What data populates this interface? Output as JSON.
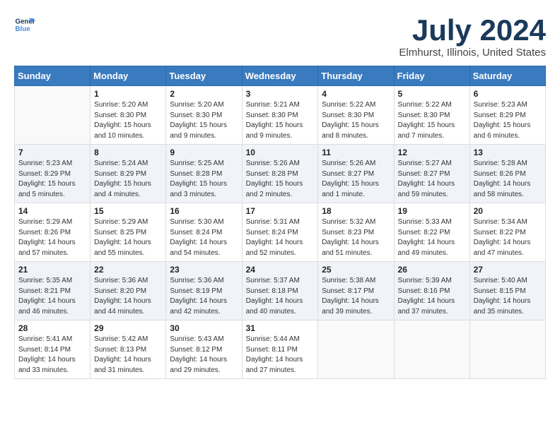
{
  "header": {
    "logo_line1": "General",
    "logo_line2": "Blue",
    "month_year": "July 2024",
    "location": "Elmhurst, Illinois, United States"
  },
  "weekdays": [
    "Sunday",
    "Monday",
    "Tuesday",
    "Wednesday",
    "Thursday",
    "Friday",
    "Saturday"
  ],
  "weeks": [
    [
      {
        "day": "",
        "sunrise": "",
        "sunset": "",
        "daylight": ""
      },
      {
        "day": "1",
        "sunrise": "Sunrise: 5:20 AM",
        "sunset": "Sunset: 8:30 PM",
        "daylight": "Daylight: 15 hours and 10 minutes."
      },
      {
        "day": "2",
        "sunrise": "Sunrise: 5:20 AM",
        "sunset": "Sunset: 8:30 PM",
        "daylight": "Daylight: 15 hours and 9 minutes."
      },
      {
        "day": "3",
        "sunrise": "Sunrise: 5:21 AM",
        "sunset": "Sunset: 8:30 PM",
        "daylight": "Daylight: 15 hours and 9 minutes."
      },
      {
        "day": "4",
        "sunrise": "Sunrise: 5:22 AM",
        "sunset": "Sunset: 8:30 PM",
        "daylight": "Daylight: 15 hours and 8 minutes."
      },
      {
        "day": "5",
        "sunrise": "Sunrise: 5:22 AM",
        "sunset": "Sunset: 8:30 PM",
        "daylight": "Daylight: 15 hours and 7 minutes."
      },
      {
        "day": "6",
        "sunrise": "Sunrise: 5:23 AM",
        "sunset": "Sunset: 8:29 PM",
        "daylight": "Daylight: 15 hours and 6 minutes."
      }
    ],
    [
      {
        "day": "7",
        "sunrise": "Sunrise: 5:23 AM",
        "sunset": "Sunset: 8:29 PM",
        "daylight": "Daylight: 15 hours and 5 minutes."
      },
      {
        "day": "8",
        "sunrise": "Sunrise: 5:24 AM",
        "sunset": "Sunset: 8:29 PM",
        "daylight": "Daylight: 15 hours and 4 minutes."
      },
      {
        "day": "9",
        "sunrise": "Sunrise: 5:25 AM",
        "sunset": "Sunset: 8:28 PM",
        "daylight": "Daylight: 15 hours and 3 minutes."
      },
      {
        "day": "10",
        "sunrise": "Sunrise: 5:26 AM",
        "sunset": "Sunset: 8:28 PM",
        "daylight": "Daylight: 15 hours and 2 minutes."
      },
      {
        "day": "11",
        "sunrise": "Sunrise: 5:26 AM",
        "sunset": "Sunset: 8:27 PM",
        "daylight": "Daylight: 15 hours and 1 minute."
      },
      {
        "day": "12",
        "sunrise": "Sunrise: 5:27 AM",
        "sunset": "Sunset: 8:27 PM",
        "daylight": "Daylight: 14 hours and 59 minutes."
      },
      {
        "day": "13",
        "sunrise": "Sunrise: 5:28 AM",
        "sunset": "Sunset: 8:26 PM",
        "daylight": "Daylight: 14 hours and 58 minutes."
      }
    ],
    [
      {
        "day": "14",
        "sunrise": "Sunrise: 5:29 AM",
        "sunset": "Sunset: 8:26 PM",
        "daylight": "Daylight: 14 hours and 57 minutes."
      },
      {
        "day": "15",
        "sunrise": "Sunrise: 5:29 AM",
        "sunset": "Sunset: 8:25 PM",
        "daylight": "Daylight: 14 hours and 55 minutes."
      },
      {
        "day": "16",
        "sunrise": "Sunrise: 5:30 AM",
        "sunset": "Sunset: 8:24 PM",
        "daylight": "Daylight: 14 hours and 54 minutes."
      },
      {
        "day": "17",
        "sunrise": "Sunrise: 5:31 AM",
        "sunset": "Sunset: 8:24 PM",
        "daylight": "Daylight: 14 hours and 52 minutes."
      },
      {
        "day": "18",
        "sunrise": "Sunrise: 5:32 AM",
        "sunset": "Sunset: 8:23 PM",
        "daylight": "Daylight: 14 hours and 51 minutes."
      },
      {
        "day": "19",
        "sunrise": "Sunrise: 5:33 AM",
        "sunset": "Sunset: 8:22 PM",
        "daylight": "Daylight: 14 hours and 49 minutes."
      },
      {
        "day": "20",
        "sunrise": "Sunrise: 5:34 AM",
        "sunset": "Sunset: 8:22 PM",
        "daylight": "Daylight: 14 hours and 47 minutes."
      }
    ],
    [
      {
        "day": "21",
        "sunrise": "Sunrise: 5:35 AM",
        "sunset": "Sunset: 8:21 PM",
        "daylight": "Daylight: 14 hours and 46 minutes."
      },
      {
        "day": "22",
        "sunrise": "Sunrise: 5:36 AM",
        "sunset": "Sunset: 8:20 PM",
        "daylight": "Daylight: 14 hours and 44 minutes."
      },
      {
        "day": "23",
        "sunrise": "Sunrise: 5:36 AM",
        "sunset": "Sunset: 8:19 PM",
        "daylight": "Daylight: 14 hours and 42 minutes."
      },
      {
        "day": "24",
        "sunrise": "Sunrise: 5:37 AM",
        "sunset": "Sunset: 8:18 PM",
        "daylight": "Daylight: 14 hours and 40 minutes."
      },
      {
        "day": "25",
        "sunrise": "Sunrise: 5:38 AM",
        "sunset": "Sunset: 8:17 PM",
        "daylight": "Daylight: 14 hours and 39 minutes."
      },
      {
        "day": "26",
        "sunrise": "Sunrise: 5:39 AM",
        "sunset": "Sunset: 8:16 PM",
        "daylight": "Daylight: 14 hours and 37 minutes."
      },
      {
        "day": "27",
        "sunrise": "Sunrise: 5:40 AM",
        "sunset": "Sunset: 8:15 PM",
        "daylight": "Daylight: 14 hours and 35 minutes."
      }
    ],
    [
      {
        "day": "28",
        "sunrise": "Sunrise: 5:41 AM",
        "sunset": "Sunset: 8:14 PM",
        "daylight": "Daylight: 14 hours and 33 minutes."
      },
      {
        "day": "29",
        "sunrise": "Sunrise: 5:42 AM",
        "sunset": "Sunset: 8:13 PM",
        "daylight": "Daylight: 14 hours and 31 minutes."
      },
      {
        "day": "30",
        "sunrise": "Sunrise: 5:43 AM",
        "sunset": "Sunset: 8:12 PM",
        "daylight": "Daylight: 14 hours and 29 minutes."
      },
      {
        "day": "31",
        "sunrise": "Sunrise: 5:44 AM",
        "sunset": "Sunset: 8:11 PM",
        "daylight": "Daylight: 14 hours and 27 minutes."
      },
      {
        "day": "",
        "sunrise": "",
        "sunset": "",
        "daylight": ""
      },
      {
        "day": "",
        "sunrise": "",
        "sunset": "",
        "daylight": ""
      },
      {
        "day": "",
        "sunrise": "",
        "sunset": "",
        "daylight": ""
      }
    ]
  ]
}
